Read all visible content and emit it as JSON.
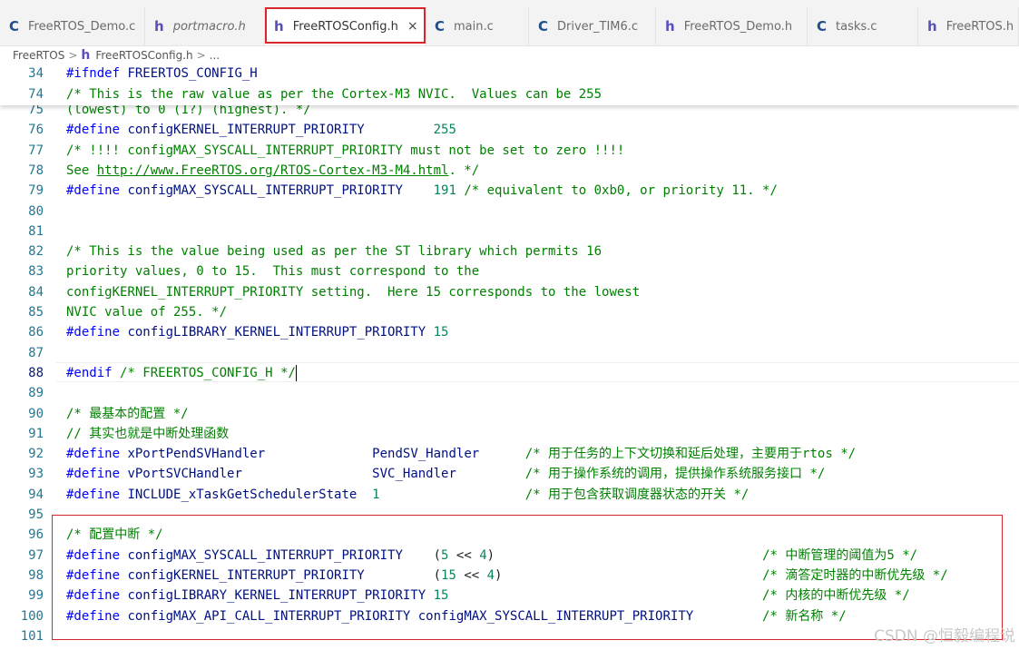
{
  "tabs": [
    {
      "icon": "C",
      "type": "c",
      "label": "FreeRTOS_Demo.c",
      "active": false,
      "italic": false
    },
    {
      "icon": "h",
      "type": "h",
      "label": "portmacro.h",
      "active": false,
      "italic": true
    },
    {
      "icon": "h",
      "type": "h",
      "label": "FreeRTOSConfig.h",
      "active": true,
      "italic": false,
      "close": "×"
    },
    {
      "icon": "C",
      "type": "c",
      "label": "main.c",
      "active": false,
      "italic": false
    },
    {
      "icon": "C",
      "type": "c",
      "label": "Driver_TIM6.c",
      "active": false,
      "italic": false
    },
    {
      "icon": "h",
      "type": "h",
      "label": "FreeRTOS_Demo.h",
      "active": false,
      "italic": false
    },
    {
      "icon": "C",
      "type": "c",
      "label": "tasks.c",
      "active": false,
      "italic": false
    },
    {
      "icon": "h",
      "type": "h",
      "label": "FreeRTOS.h",
      "active": false,
      "italic": false
    }
  ],
  "breadcrumb": {
    "folder": "FreeRTOS",
    "sep1": ">",
    "file_icon": "h",
    "file": "FreeRTOSConfig.h",
    "sep2": ">",
    "more": "..."
  },
  "sticky_lines": [
    {
      "n": "34",
      "parts": [
        [
          "kw",
          "#ifndef "
        ],
        [
          "id",
          "FREERTOS_CONFIG_H"
        ]
      ]
    },
    {
      "n": "74",
      "parts": [
        [
          "cm",
          "/* This is the raw value as per the Cortex-M3 NVIC.  Values can be 255"
        ]
      ]
    }
  ],
  "lines": [
    {
      "n": "75",
      "parts": [
        [
          "cm",
          "(lowest) to 0 (1?) (highest). */"
        ]
      ]
    },
    {
      "n": "76",
      "parts": [
        [
          "kw",
          "#define "
        ],
        [
          "id",
          "configKERNEL_INTERRUPT_PRIORITY"
        ],
        [
          "plain",
          "         "
        ],
        [
          "num",
          "255"
        ]
      ]
    },
    {
      "n": "77",
      "parts": [
        [
          "cm",
          "/* !!!! configMAX_SYSCALL_INTERRUPT_PRIORITY must not be set to zero !!!!"
        ]
      ]
    },
    {
      "n": "78",
      "parts": [
        [
          "cm",
          "See "
        ],
        [
          "cmurl",
          "http://www.FreeRTOS.org/RTOS-Cortex-M3-M4.html"
        ],
        [
          "cm",
          ". */"
        ]
      ]
    },
    {
      "n": "79",
      "parts": [
        [
          "kw",
          "#define "
        ],
        [
          "id",
          "configMAX_SYSCALL_INTERRUPT_PRIORITY"
        ],
        [
          "plain",
          "    "
        ],
        [
          "num",
          "191"
        ],
        [
          "cm",
          " /* equivalent to 0xb0, or priority 11. */"
        ]
      ]
    },
    {
      "n": "80",
      "parts": []
    },
    {
      "n": "81",
      "parts": []
    },
    {
      "n": "82",
      "parts": [
        [
          "cm",
          "/* This is the value being used as per the ST library which permits 16"
        ]
      ]
    },
    {
      "n": "83",
      "parts": [
        [
          "cm",
          "priority values, 0 to 15.  This must correspond to the"
        ]
      ]
    },
    {
      "n": "84",
      "parts": [
        [
          "cm",
          "configKERNEL_INTERRUPT_PRIORITY setting.  Here 15 corresponds to the lowest"
        ]
      ]
    },
    {
      "n": "85",
      "parts": [
        [
          "cm",
          "NVIC value of 255. */"
        ]
      ]
    },
    {
      "n": "86",
      "parts": [
        [
          "kw",
          "#define "
        ],
        [
          "id",
          "configLIBRARY_KERNEL_INTERRUPT_PRIORITY"
        ],
        [
          "plain",
          " "
        ],
        [
          "num",
          "15"
        ]
      ]
    },
    {
      "n": "87",
      "parts": []
    },
    {
      "n": "88",
      "parts": [
        [
          "kw",
          "#endif "
        ],
        [
          "cm",
          "/* FREERTOS_CONFIG_H */"
        ]
      ],
      "current": true
    },
    {
      "n": "89",
      "parts": []
    },
    {
      "n": "90",
      "parts": [
        [
          "cm",
          "/* 最基本的配置 */"
        ]
      ]
    },
    {
      "n": "91",
      "parts": [
        [
          "cm",
          "// 其实也就是中断处理函数"
        ]
      ]
    },
    {
      "n": "92",
      "parts": [
        [
          "kw",
          "#define "
        ],
        [
          "id",
          "xPortPendSVHandler"
        ],
        [
          "plain",
          "              "
        ],
        [
          "id",
          "PendSV_Handler"
        ],
        [
          "plain",
          "      "
        ],
        [
          "cm",
          "/* 用于任务的上下文切换和延后处理，主要用于rtos */"
        ]
      ]
    },
    {
      "n": "93",
      "parts": [
        [
          "kw",
          "#define "
        ],
        [
          "id",
          "vPortSVCHandler"
        ],
        [
          "plain",
          "                 "
        ],
        [
          "id",
          "SVC_Handler"
        ],
        [
          "plain",
          "         "
        ],
        [
          "cm",
          "/* 用于操作系统的调用，提供操作系统服务接口 */"
        ]
      ]
    },
    {
      "n": "94",
      "parts": [
        [
          "kw",
          "#define "
        ],
        [
          "id",
          "INCLUDE_xTaskGetSchedulerState"
        ],
        [
          "plain",
          "  "
        ],
        [
          "num",
          "1"
        ],
        [
          "plain",
          "                   "
        ],
        [
          "cm",
          "/* 用于包含获取调度器状态的开关 */"
        ]
      ]
    },
    {
      "n": "95",
      "parts": []
    },
    {
      "n": "96",
      "parts": [
        [
          "cm",
          "/* 配置中断 */"
        ]
      ]
    },
    {
      "n": "97",
      "parts": [
        [
          "kw",
          "#define "
        ],
        [
          "id",
          "configMAX_SYSCALL_INTERRUPT_PRIORITY"
        ],
        [
          "plain",
          "    ("
        ],
        [
          "num",
          "5"
        ],
        [
          "plain",
          " << "
        ],
        [
          "num",
          "4"
        ],
        [
          "plain",
          ")                                   "
        ],
        [
          "cm",
          "/* 中断管理的阈值为5 */"
        ]
      ]
    },
    {
      "n": "98",
      "parts": [
        [
          "kw",
          "#define "
        ],
        [
          "id",
          "configKERNEL_INTERRUPT_PRIORITY"
        ],
        [
          "plain",
          "         ("
        ],
        [
          "num",
          "15"
        ],
        [
          "plain",
          " << "
        ],
        [
          "num",
          "4"
        ],
        [
          "plain",
          ")                                  "
        ],
        [
          "cm",
          "/* 滴答定时器的中断优先级 */"
        ]
      ]
    },
    {
      "n": "99",
      "parts": [
        [
          "kw",
          "#define "
        ],
        [
          "id",
          "configLIBRARY_KERNEL_INTERRUPT_PRIORITY"
        ],
        [
          "plain",
          " "
        ],
        [
          "num",
          "15"
        ],
        [
          "plain",
          "                                         "
        ],
        [
          "cm",
          "/* 内核的中断优先级 */"
        ]
      ]
    },
    {
      "n": "100",
      "parts": [
        [
          "kw",
          "#define "
        ],
        [
          "id",
          "configMAX_API_CALL_INTERRUPT_PRIORITY"
        ],
        [
          "plain",
          " "
        ],
        [
          "id",
          "configMAX_SYSCALL_INTERRUPT_PRIORITY"
        ],
        [
          "plain",
          "         "
        ],
        [
          "cm",
          "/* 新名称 */"
        ]
      ]
    },
    {
      "n": "101",
      "parts": []
    }
  ],
  "watermark": "CSDN @恒毅编程说"
}
